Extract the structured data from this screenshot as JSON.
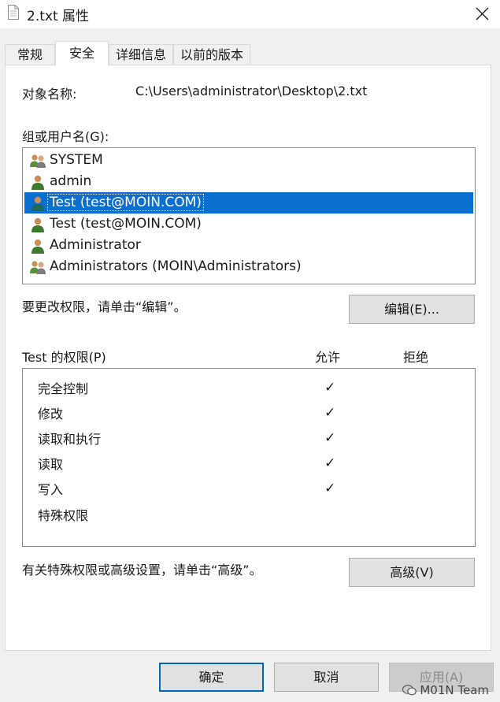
{
  "window": {
    "title": "2.txt 属性",
    "icon": "file-icon"
  },
  "tabs": [
    {
      "label": "常规"
    },
    {
      "label": "安全"
    },
    {
      "label": "详细信息"
    },
    {
      "label": "以前的版本"
    }
  ],
  "security": {
    "object_label": "对象名称:",
    "object_value": "C:\\Users\\administrator\\Desktop\\2.txt",
    "groups_label": "组或用户名(G):",
    "users": [
      {
        "name": "SYSTEM",
        "icon": "group-icon"
      },
      {
        "name": "admin",
        "icon": "user-icon"
      },
      {
        "name": "Test (test@MOIN.COM)",
        "icon": "user-icon"
      },
      {
        "name": "Test (test@MOIN.COM)",
        "icon": "user-icon"
      },
      {
        "name": "Administrator",
        "icon": "user-icon"
      },
      {
        "name": "Administrators (MOIN\\Administrators)",
        "icon": "group-icon"
      }
    ],
    "selected_user": "Test (test@MOIN.COM)",
    "edit_hint": "要更改权限，请单击“编辑”。",
    "edit_button": "编辑(E)...",
    "perm_label": "Test 的权限(P)",
    "allow_header": "允许",
    "deny_header": "拒绝",
    "permissions": [
      {
        "name": "完全控制",
        "allow": "✓",
        "deny": ""
      },
      {
        "name": "修改",
        "allow": "✓",
        "deny": ""
      },
      {
        "name": "读取和执行",
        "allow": "✓",
        "deny": ""
      },
      {
        "name": "读取",
        "allow": "✓",
        "deny": ""
      },
      {
        "name": "写入",
        "allow": "✓",
        "deny": ""
      },
      {
        "name": "特殊权限",
        "allow": "",
        "deny": ""
      }
    ],
    "advanced_hint": "有关特殊权限或高级设置，请单击“高级”。",
    "advanced_button": "高级(V)"
  },
  "footer": {
    "ok": "确定",
    "cancel": "取消",
    "apply": "应用(A)"
  },
  "watermark": "M01N Team",
  "colors": {
    "selection": "#0b6fd0",
    "default_button_border": "#0067c0"
  }
}
